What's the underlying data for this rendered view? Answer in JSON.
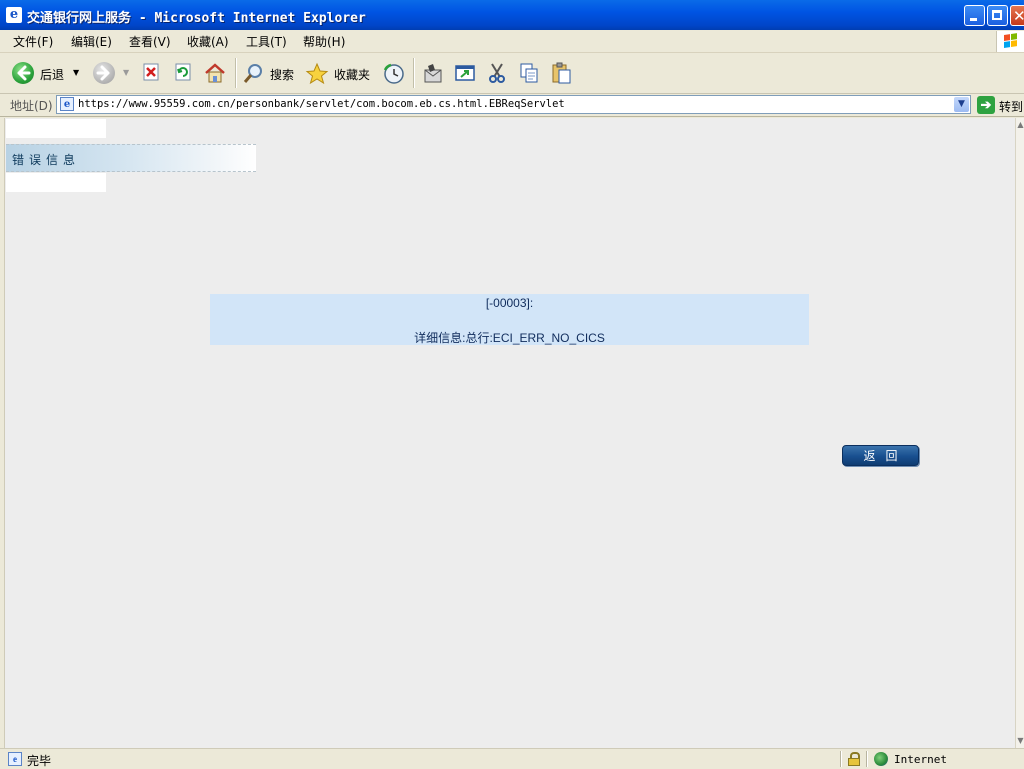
{
  "window": {
    "title": "交通银行网上服务 - Microsoft Internet Explorer"
  },
  "menu": {
    "items": [
      "文件(F)",
      "编辑(E)",
      "查看(V)",
      "收藏(A)",
      "工具(T)",
      "帮助(H)"
    ]
  },
  "toolbar": {
    "back_label": "后退",
    "search_label": "搜索",
    "favorites_label": "收藏夹"
  },
  "address": {
    "label": "地址(D)",
    "url": "https://www.95559.com.cn/personbank/servlet/com.bocom.eb.cs.html.EBReqServlet",
    "go_label": "转到"
  },
  "page": {
    "section_title": "错误信息",
    "error_code": "[-00003]:",
    "error_detail": "详细信息:总行:ECI_ERR_NO_CICS",
    "return_button": "返回"
  },
  "status": {
    "text": "完毕",
    "zone": "Internet"
  },
  "colors": {
    "titlebar": "#0054E3",
    "error_box": "#D2E5F8",
    "return_button": "#184F8F",
    "page_bg": "#EDEDED"
  }
}
